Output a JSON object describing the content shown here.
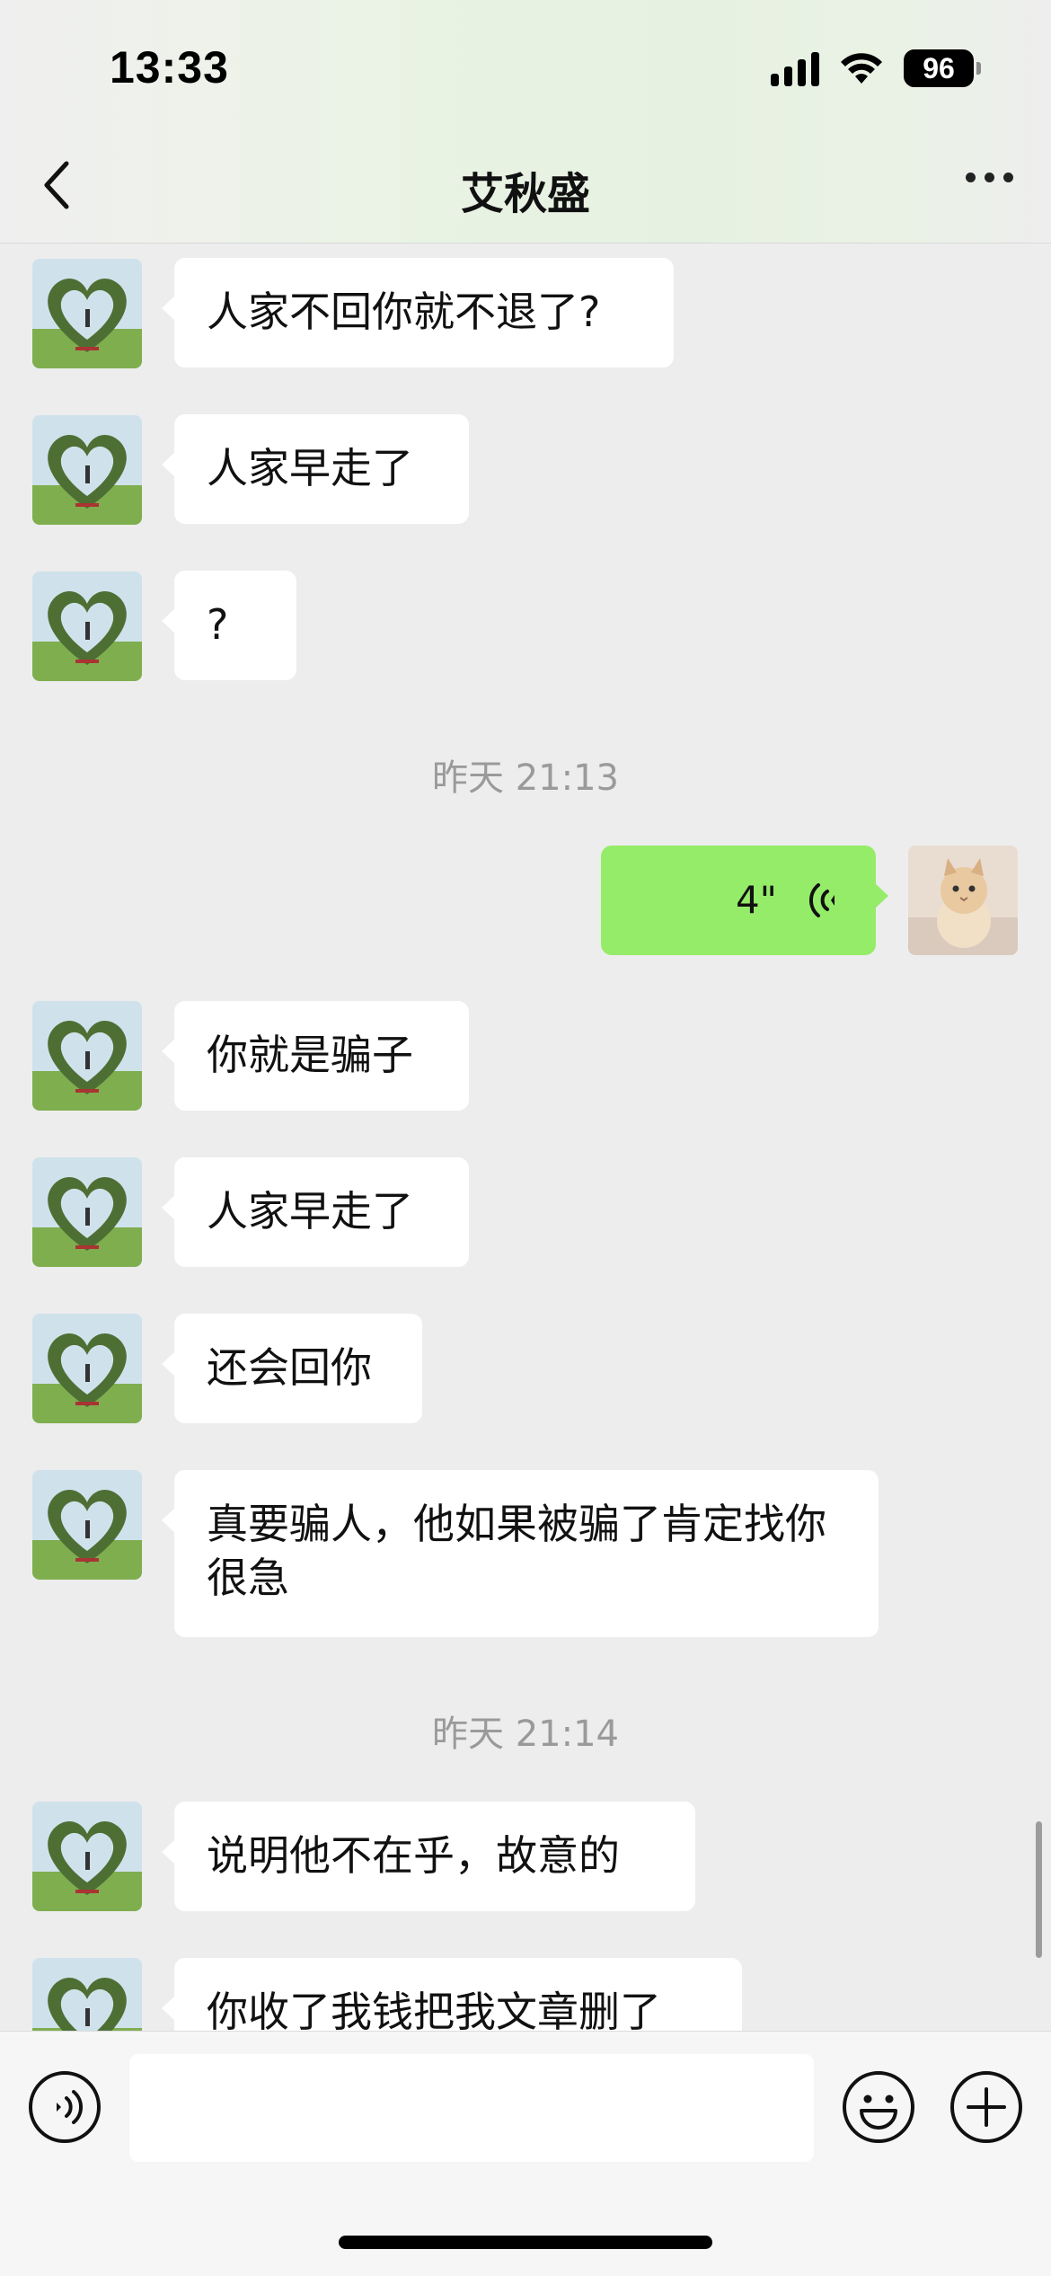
{
  "status_bar": {
    "time": "13:33",
    "battery": "96"
  },
  "header": {
    "title": "艾秋盛",
    "back_icon": "chevron-left-icon",
    "more_icon": "ellipsis-icon"
  },
  "messages": [
    {
      "side": "left",
      "text": "人家不回你就不退了?"
    },
    {
      "side": "left",
      "text": "人家早走了"
    },
    {
      "side": "left",
      "text": "?"
    },
    {
      "timestamp": "昨天 21:13"
    },
    {
      "side": "right",
      "type": "voice",
      "duration": "4\""
    },
    {
      "side": "left",
      "text": "你就是骗子"
    },
    {
      "side": "left",
      "text": "人家早走了"
    },
    {
      "side": "left",
      "text": "还会回你"
    },
    {
      "side": "left",
      "text": "真要骗人，他如果被骗了肯定找你很急"
    },
    {
      "timestamp": "昨天 21:14"
    },
    {
      "side": "left",
      "text": "说明他不在乎，故意的"
    },
    {
      "side": "left",
      "text": "你收了我钱把我文章删了"
    }
  ],
  "input_bar": {
    "voice_icon": "voice-input-icon",
    "emoji_icon": "emoji-icon",
    "plus_icon": "plus-icon",
    "placeholder": ""
  },
  "colors": {
    "sent_bubble": "#95ec69",
    "received_bubble": "#ffffff",
    "background": "#ededed"
  }
}
